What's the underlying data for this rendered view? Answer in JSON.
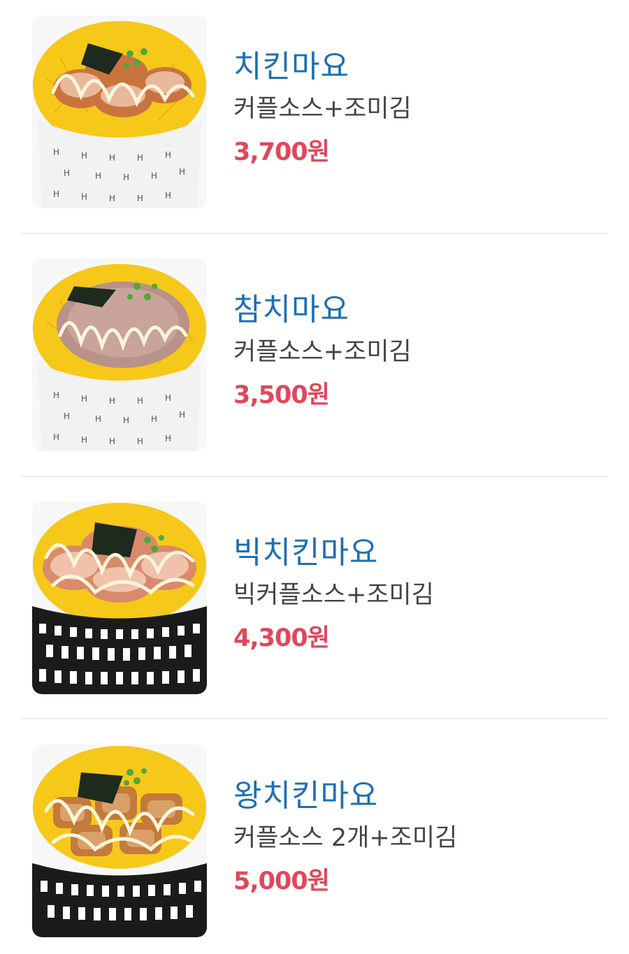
{
  "menu": {
    "items": [
      {
        "name": "치킨마요",
        "description": "커플소스+조미김",
        "price": "3,700원",
        "image": "chicken-mayo-bowl",
        "topping": "chicken",
        "cup": "white"
      },
      {
        "name": "참치마요",
        "description": "커플소스+조미김",
        "price": "3,500원",
        "image": "tuna-mayo-bowl",
        "topping": "tuna",
        "cup": "white"
      },
      {
        "name": "빅치킨마요",
        "description": "빅커플소스+조미김",
        "price": "4,300원",
        "image": "big-chicken-mayo-bowl",
        "topping": "chicken",
        "cup": "dark"
      },
      {
        "name": "왕치킨마요",
        "description": "커플소스 2개+조미김",
        "price": "5,000원",
        "image": "king-chicken-mayo-bowl",
        "topping": "fried-chicken",
        "cup": "dark"
      }
    ]
  },
  "colors": {
    "name": "#1d6fb5",
    "description": "#444444",
    "price": "#e0485a",
    "divider": "#ececec",
    "egg": "#f6c81a"
  }
}
